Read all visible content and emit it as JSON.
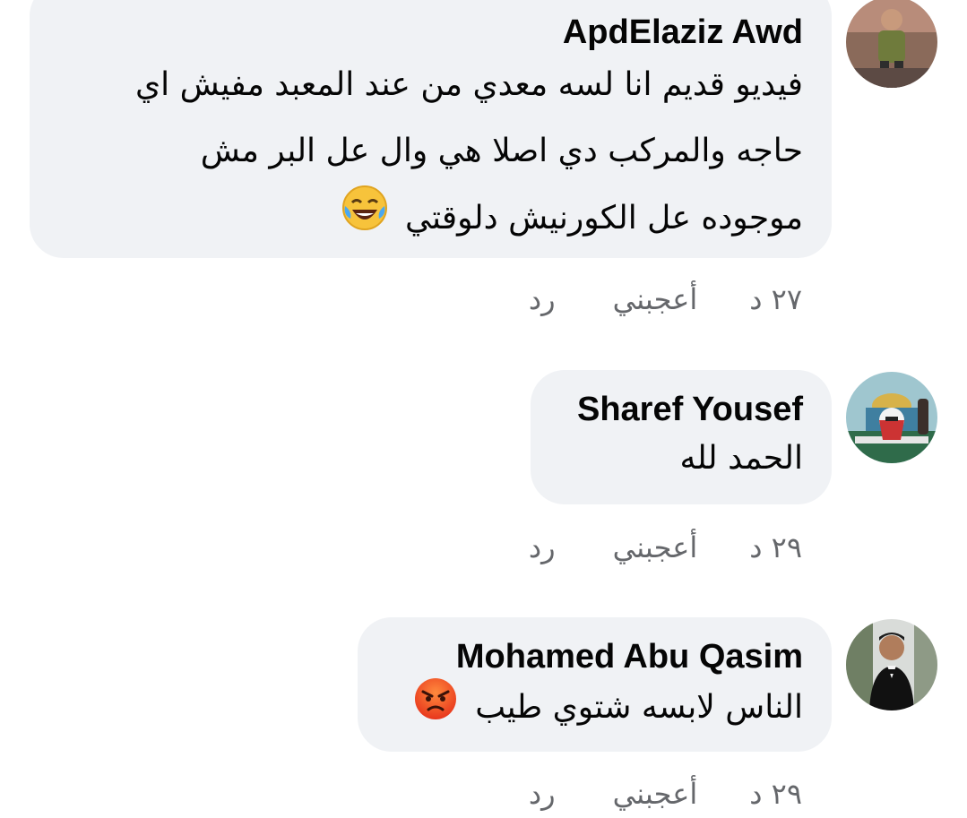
{
  "comments": [
    {
      "author": "ApdElaziz Awd",
      "lines": [
        "فيديو قديم انا لسه معدي من عند المعبد مفيش اي",
        "حاجه والمركب دي اصلا هي وال عل البر مش",
        "موجوده عل الكورنيش دلوقتي"
      ],
      "emoji": "laughing-crying-emoji",
      "time": "٢٧ د",
      "like_label": "أعجبني",
      "reply_label": "رد"
    },
    {
      "author": "Sharef Yousef",
      "lines": [
        "الحمد لله"
      ],
      "time": "٢٩ د",
      "like_label": "أعجبني",
      "reply_label": "رد"
    },
    {
      "author": "Mohamed Abu Qasim",
      "lines": [
        "الناس لابسه شتوي طيب"
      ],
      "emoji": "angry-face-emoji",
      "time": "٢٩ د",
      "like_label": "أعجبني",
      "reply_label": "رد"
    }
  ],
  "colors": {
    "bubble": "#f0f2f5",
    "text": "#050505",
    "meta": "#65676b"
  }
}
